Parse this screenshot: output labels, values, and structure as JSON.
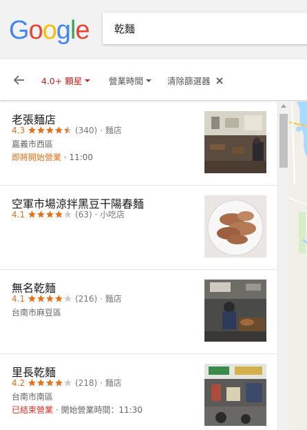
{
  "logo": {
    "letters": [
      "G",
      "o",
      "o",
      "g",
      "l",
      "e"
    ],
    "colors": [
      "#4285f4",
      "#ea4335",
      "#fbbc05",
      "#4285f4",
      "#34a853",
      "#ea4335"
    ]
  },
  "search": {
    "value": "乾麵"
  },
  "filters": {
    "rating": "4.0+ 顆星",
    "hours": "營業時間",
    "clear": "清除篩選器"
  },
  "colors": {
    "accent_red": "#c5221f",
    "star": "#e7711b",
    "closed": "#d93025"
  },
  "results": [
    {
      "name": "老張麵店",
      "rating": "4.3",
      "stars": 4.5,
      "reviews": "(340)",
      "separator": "·",
      "category": "麵店",
      "address": "嘉義市西區",
      "status": "即將開始營業",
      "status_extra": "· 11:00"
    },
    {
      "name": "空軍市場涼拌黑豆干陽春麵",
      "rating": "4.1",
      "stars": 4,
      "reviews": "(63)",
      "separator": "·",
      "category": "小吃店"
    },
    {
      "name": "無名乾麵",
      "rating": "4.1",
      "stars": 4,
      "reviews": "(216)",
      "separator": "·",
      "category": "麵店",
      "address": "台南市麻豆區"
    },
    {
      "name": "里長乾麵",
      "rating": "4.2",
      "stars": 4,
      "reviews": "(218)",
      "separator": "·",
      "category": "麵店",
      "address": "台南市南區",
      "status": "已結束營業",
      "status_extra": "· 開始營業時間：11:30"
    }
  ]
}
